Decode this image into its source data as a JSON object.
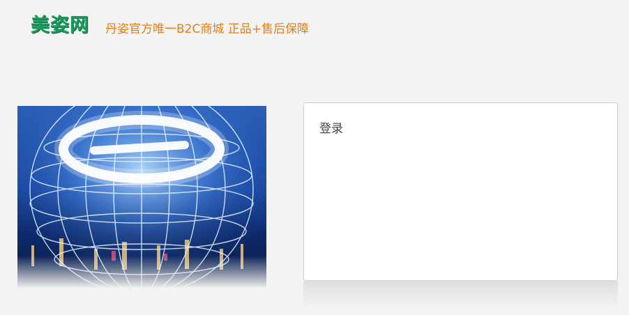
{
  "header": {
    "logo_text": "美姿网",
    "slogan": "丹姿官方唯一B2C商城 正品+售后保障"
  },
  "hero": {
    "image_icon": "globe-e-logo-image"
  },
  "login": {
    "title": "登录"
  },
  "colors": {
    "logo": "#1a9a5c",
    "slogan": "#e87c12",
    "background": "#f3f3f3"
  }
}
